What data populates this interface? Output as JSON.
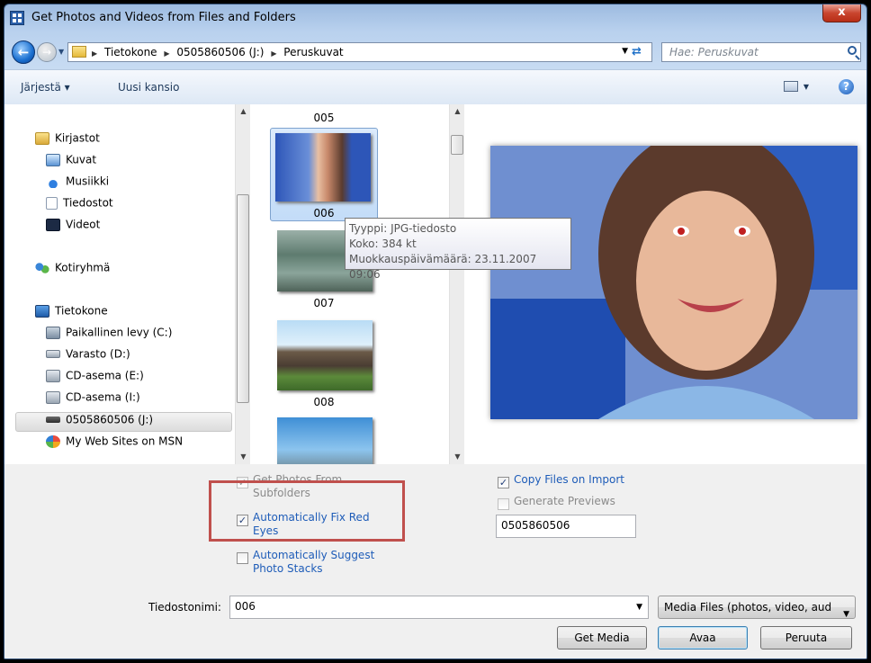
{
  "window": {
    "title": "Get Photos and Videos from Files and Folders",
    "close_label": "x"
  },
  "address": {
    "crumbs": [
      "Tietokone",
      "0505860506 (J:)",
      "Peruskuvat"
    ],
    "search_placeholder": "Hae: Peruskuvat"
  },
  "toolbar": {
    "organize_label": "Järjestä ▾",
    "new_folder_label": "Uusi kansio",
    "help_label": "?"
  },
  "nav": {
    "items": [
      {
        "label": "Kirjastot",
        "icon": "library-icon"
      },
      {
        "label": "Kuvat",
        "icon": "pictures-icon"
      },
      {
        "label": "Musiikki",
        "icon": "music-icon"
      },
      {
        "label": "Tiedostot",
        "icon": "documents-icon"
      },
      {
        "label": "Videot",
        "icon": "videos-icon"
      },
      {
        "label": "Kotiryhmä",
        "icon": "homegroup-icon"
      },
      {
        "label": "Tietokone",
        "icon": "computer-icon"
      },
      {
        "label": "Paikallinen levy (C:)",
        "icon": "local-disk-icon"
      },
      {
        "label": "Varasto (D:)",
        "icon": "drive-icon"
      },
      {
        "label": "CD-asema (E:)",
        "icon": "cd-drive-icon"
      },
      {
        "label": "CD-asema (I:)",
        "icon": "cd-drive-icon"
      },
      {
        "label": "0505860506 (J:)",
        "icon": "removable-drive-icon"
      },
      {
        "label": "My Web Sites on MSN",
        "icon": "msn-icon"
      }
    ],
    "selected": "0505860506 (J:)"
  },
  "files": {
    "items": [
      {
        "name": "005"
      },
      {
        "name": "006",
        "selected": true
      },
      {
        "name": "007"
      },
      {
        "name": "008"
      }
    ]
  },
  "tooltip": {
    "type": "Tyyppi: JPG-tiedosto",
    "size": "Koko: 384 kt",
    "modified": "Muokkauspäivämäärä: 23.11.2007 09:06"
  },
  "options": {
    "subfolders": {
      "label": "Get Photos From Subfolders",
      "checked": true,
      "enabled": false
    },
    "fix_red_eyes": {
      "label": "Automatically Fix Red Eyes",
      "checked": true
    },
    "suggest_stacks": {
      "label": "Automatically Suggest Photo Stacks",
      "checked": false
    },
    "copy_files": {
      "label": "Copy Files on Import",
      "checked": true
    },
    "generate_previews": {
      "label": "Generate Previews",
      "checked": false,
      "enabled": false
    },
    "folder_name_value": "0505860506"
  },
  "filename": {
    "label": "Tiedostonimi:",
    "value": "006"
  },
  "filetype": {
    "value": "Media Files (photos, video, aud"
  },
  "buttons": {
    "get_media": "Get Media",
    "open": "Avaa",
    "cancel": "Peruuta"
  },
  "colors": {
    "highlight_frame": "#c0504d",
    "link_blue": "#1e5cb8",
    "selection": "#cce4fc"
  }
}
